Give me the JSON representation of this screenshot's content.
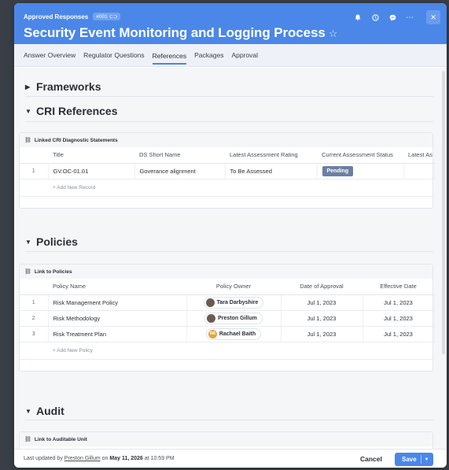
{
  "header": {
    "breadcrumb": "Approved Responses",
    "record_id": "#001",
    "title": "Security Event Monitoring and Logging Process",
    "star_icon": "☆",
    "icons": [
      "bell-icon",
      "clock-icon",
      "chat-icon",
      "more-icon",
      "close-icon"
    ]
  },
  "tabs": [
    {
      "label": "Answer Overview"
    },
    {
      "label": "Regulator Questions"
    },
    {
      "label": "References",
      "active": true
    },
    {
      "label": "Packages"
    },
    {
      "label": "Approval"
    }
  ],
  "sections": {
    "frameworks": {
      "title": "Frameworks",
      "expanded": false
    },
    "cri": {
      "title": "CRI References",
      "expanded": true,
      "card_title": "Linked CRI Diagnostic Statements",
      "columns": [
        "Title",
        "DS Short Name",
        "Latest Assessment Rating",
        "Current Assessment Status",
        "Latest As"
      ],
      "rows": [
        {
          "num": "1",
          "title": "GV.OC-01.01",
          "short_name": "Goverance alignment",
          "rating": "To Be Assessed",
          "status": "Pending",
          "latest": ""
        }
      ],
      "add_label": "+ Add New Record"
    },
    "policies": {
      "title": "Policies",
      "expanded": true,
      "card_title": "Link to Policies",
      "columns": [
        "Policy Name",
        "Policy Owner",
        "Date of Approval",
        "Effective Date"
      ],
      "rows": [
        {
          "num": "1",
          "name": "Risk Management Policy",
          "owner": "Tara Darbyshire",
          "owner_avatar": "photo",
          "approval": "Jul 1, 2023",
          "effective": "Jul 1, 2023"
        },
        {
          "num": "2",
          "name": "Risk Methodology",
          "owner": "Preston Gillum",
          "owner_avatar": "photo",
          "approval": "Jul 1, 2023",
          "effective": "Jul 1, 2023"
        },
        {
          "num": "3",
          "name": "Risk Treatment Plan",
          "owner": "Rachael Baith",
          "owner_avatar": "RB",
          "approval": "Jul 1, 2023",
          "effective": "Jul 1, 2023"
        }
      ],
      "add_label": "+ Add New Policy"
    },
    "audit": {
      "title": "Audit",
      "expanded": true,
      "card_title": "Link to Auditable Unit"
    }
  },
  "footer": {
    "updated_prefix": "Last updated by",
    "updated_user": "Preston Gillum",
    "updated_on": "on",
    "updated_date": "May 11, 2026",
    "updated_time": "at 10:59 PM",
    "cancel_label": "Cancel",
    "save_label": "Save"
  },
  "colors": {
    "accent": "#4a87e8",
    "pending_badge": "#6b7fa3",
    "avatar_initials": "#e8a33a"
  }
}
